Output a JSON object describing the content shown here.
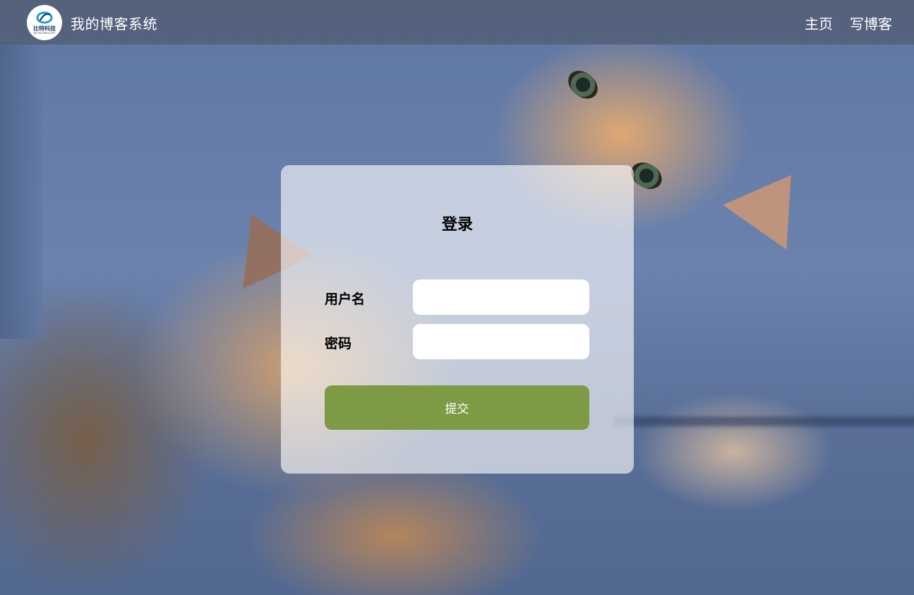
{
  "header": {
    "logo": {
      "icon": "bit-tech-logo",
      "text": "比特科技",
      "subtext": "BIT-TECHNOLOGY",
      "color": "#1aa0c8"
    },
    "site_title": "我的博客系统",
    "nav": [
      {
        "label": "主页"
      },
      {
        "label": "写博客"
      }
    ]
  },
  "login": {
    "title": "登录",
    "username_label": "用户名",
    "username_value": "",
    "password_label": "密码",
    "password_value": "",
    "submit_label": "提交",
    "submit_color": "#7d9a45"
  },
  "background": {
    "description_icon": "cats-on-sofa-photo"
  }
}
